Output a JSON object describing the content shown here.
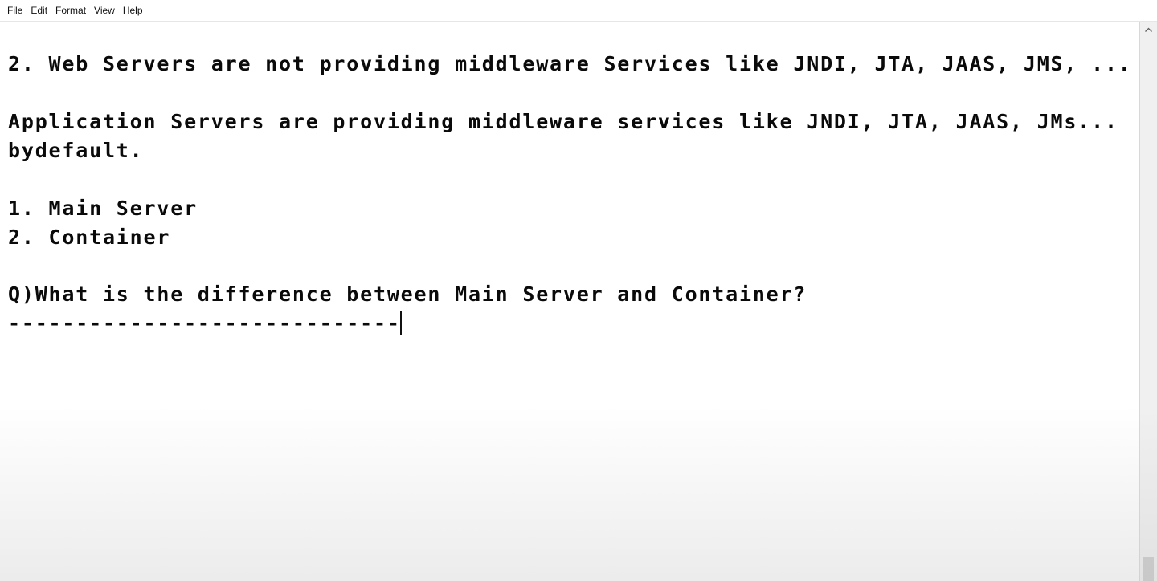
{
  "menubar": {
    "items": [
      {
        "label": "File"
      },
      {
        "label": "Edit"
      },
      {
        "label": "Format"
      },
      {
        "label": "View"
      },
      {
        "label": "Help"
      }
    ]
  },
  "document": {
    "lines": [
      "2. Web Servers are not providing middleware Services like JNDI, JTA, JAAS, JMS, ...",
      "Application Servers are providing middleware services like JNDI, JTA, JAAS, JMs...",
      "bydefault.",
      "1. Main Server",
      "2. Container",
      "Q)What is the difference between Main Server and Container?",
      "-----------------------------"
    ]
  },
  "icons": {
    "scroll_up": "chevron-up-icon"
  }
}
